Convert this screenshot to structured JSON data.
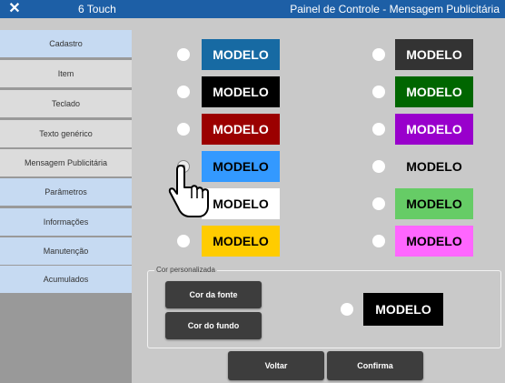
{
  "header": {
    "close_symbol": "✕",
    "app_name": "6 Touch",
    "window_title": "Painel de Controle - Mensagem Publicitária",
    "bar_color": "#1d5fa6"
  },
  "sidebar": {
    "items": [
      {
        "label": "Cadastro"
      },
      {
        "label": "Item"
      },
      {
        "label": "Teclado"
      },
      {
        "label": "Texto genérico"
      },
      {
        "label": "Mensagem Publicitária"
      },
      {
        "label": "Parâmetros"
      },
      {
        "label": "Informações"
      },
      {
        "label": "Manutenção"
      },
      {
        "label": "Acumulados"
      }
    ]
  },
  "swatches": {
    "left": [
      {
        "label": "MODELO",
        "bg": "#176aa3",
        "fg": "#ffffff"
      },
      {
        "label": "MODELO",
        "bg": "#000000",
        "fg": "#ffffff"
      },
      {
        "label": "MODELO",
        "bg": "#9b0000",
        "fg": "#ffffff"
      },
      {
        "label": "MODELO",
        "bg": "#3399ff",
        "fg": "#000000"
      },
      {
        "label": "MODELO",
        "bg": "#ffffff",
        "fg": "#000000"
      },
      {
        "label": "MODELO",
        "bg": "#ffcc00",
        "fg": "#000000"
      }
    ],
    "right": [
      {
        "label": "MODELO",
        "bg": "#333333",
        "fg": "#ffffff"
      },
      {
        "label": "MODELO",
        "bg": "#006600",
        "fg": "#ffffff"
      },
      {
        "label": "MODELO",
        "bg": "#9900cc",
        "fg": "#ffffff"
      },
      {
        "label": "MODELO",
        "bg": "#c9c9c9",
        "fg": "#000000"
      },
      {
        "label": "MODELO",
        "bg": "#66cc66",
        "fg": "#000000"
      },
      {
        "label": "MODELO",
        "bg": "#ff66ff",
        "fg": "#000000"
      }
    ]
  },
  "selected_swatch": "left-4",
  "custom": {
    "legend": "Cor personalizada",
    "font_color_label": "Cor da fonte",
    "background_color_label": "Cor do fundo",
    "preview_label": "MODELO",
    "preview_bg": "#000000",
    "preview_fg": "#ffffff"
  },
  "footer": {
    "back_label": "Voltar",
    "confirm_label": "Confirma"
  },
  "icons": {
    "close": "close-icon",
    "cursor": "hand-pointer-icon"
  }
}
